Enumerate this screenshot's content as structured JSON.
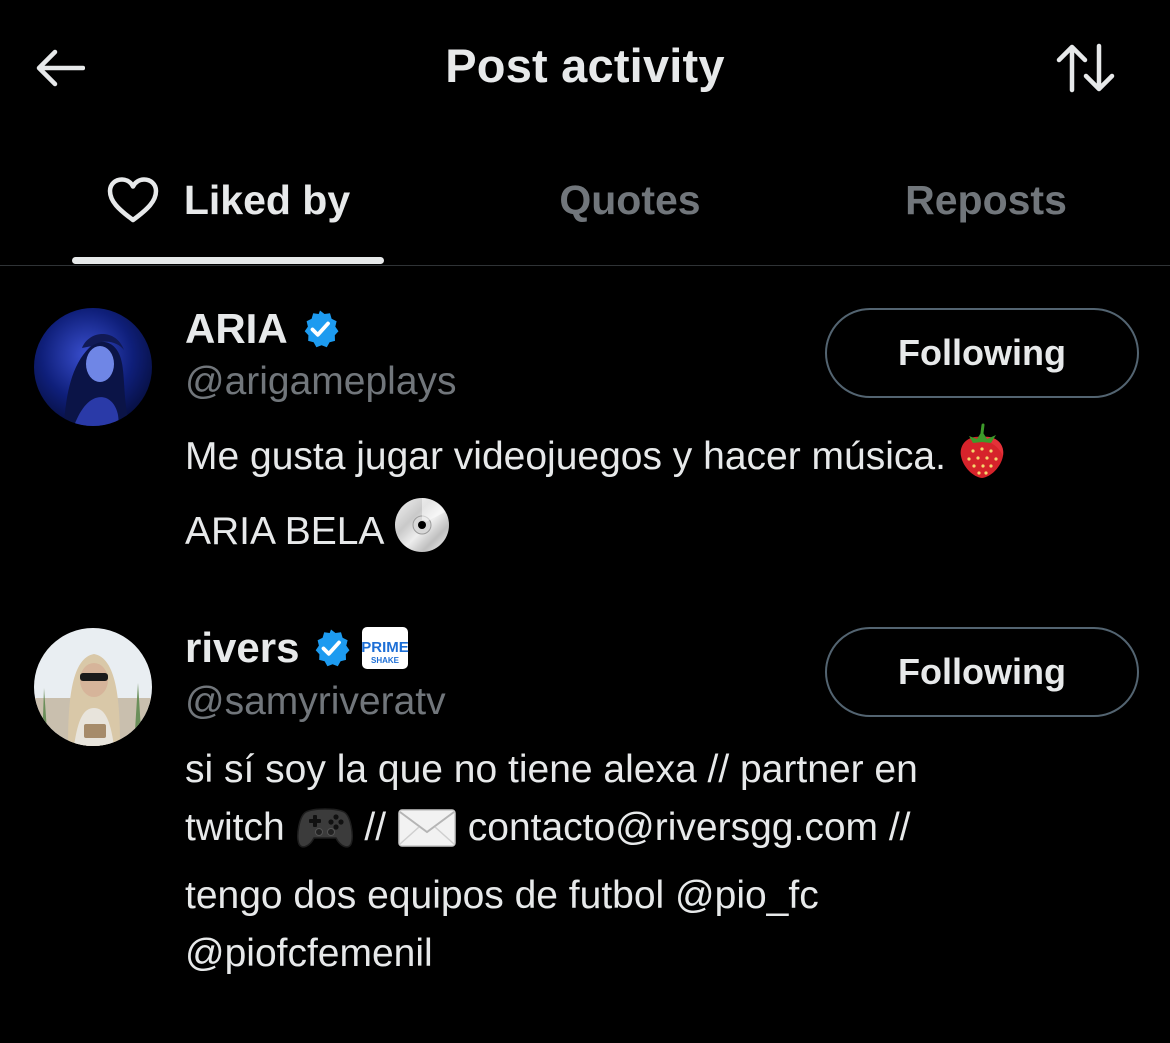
{
  "header": {
    "title": "Post activity",
    "back_icon": "arrow-left-icon",
    "sort_icon": "sort-arrows-icon"
  },
  "tabs": [
    {
      "label": "Liked by",
      "active": true,
      "icon": "heart-outline-icon"
    },
    {
      "label": "Quotes",
      "active": false
    },
    {
      "label": "Reposts",
      "active": false
    }
  ],
  "users": [
    {
      "name": "ARIA",
      "verified": true,
      "handle": "@arigameplays",
      "follow_label": "Following",
      "bio_line1": "Me gusta jugar videojuegos y hacer música.",
      "bio_line2": "ARIA BELA",
      "bio_emojis": [
        "strawberry-emoji",
        "cd-disc-emoji"
      ]
    },
    {
      "name": "rivers",
      "verified": true,
      "affiliate_badge": "PRIME",
      "affiliate_badge_sub": "SHAKE",
      "handle": "@samyriveratv",
      "follow_label": "Following",
      "bio_line1": "si sí soy la que no tiene alexa // partner en",
      "bio_line2_a": "twitch",
      "bio_line2_b": "//",
      "bio_line2_c": "contacto@riversgg.com //",
      "bio_line3": "tengo dos equipos de futbol @pio_fc",
      "bio_line4": "@piofcfemenil",
      "bio_emojis": [
        "game-controller-emoji",
        "envelope-emoji"
      ]
    }
  ],
  "colors": {
    "background": "#000000",
    "text_primary": "#e7e9ea",
    "text_secondary": "#71767b",
    "verified_blue": "#1d9bf0",
    "divider": "#2f3336"
  }
}
